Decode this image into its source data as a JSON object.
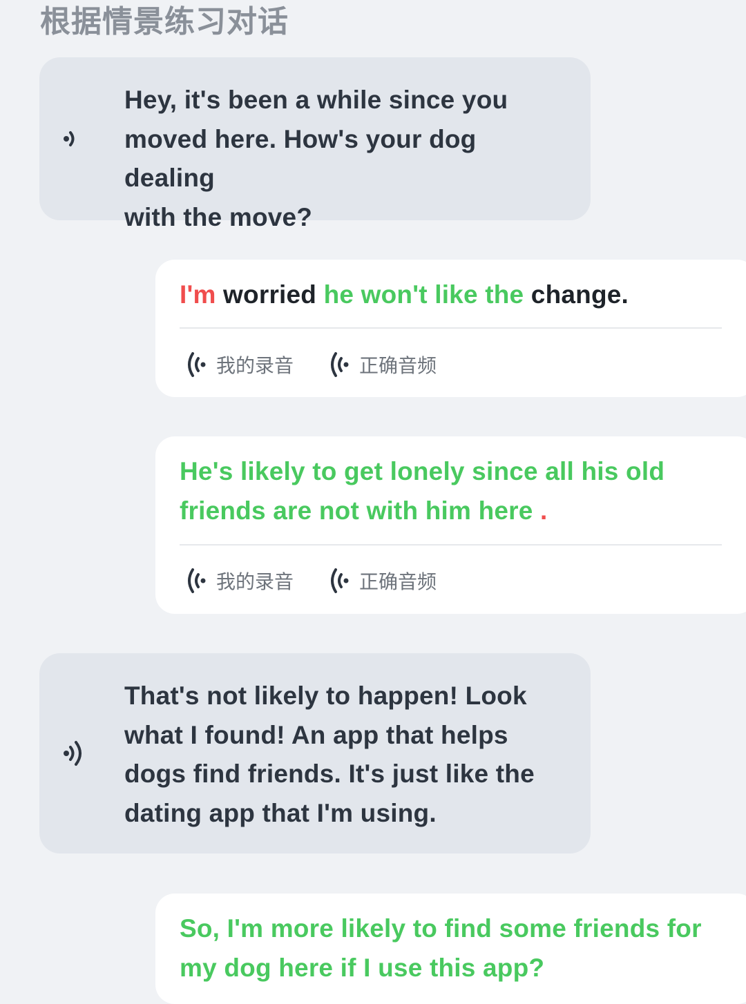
{
  "page": {
    "title": "根据情景练习对话"
  },
  "messages": [
    {
      "role": "partner",
      "text_lines": [
        "Hey, it's been a while since you",
        "moved here. How's your dog dealing",
        "with the move?"
      ],
      "speaker_icon": "speaker-icon"
    },
    {
      "role": "user",
      "segments": [
        {
          "text": "I'm",
          "color": "red"
        },
        {
          "text": " worried ",
          "color": "black"
        },
        {
          "text": "he won't like the",
          "color": "green"
        },
        {
          "text": " change.",
          "color": "black"
        }
      ],
      "my_recording_label": "我的录音",
      "correct_audio_label": "正确音频"
    },
    {
      "role": "user",
      "lines": [
        [
          {
            "text": "He's likely to get lonely since all his old",
            "color": "green"
          }
        ],
        [
          {
            "text": "friends are not with him here",
            "color": "green"
          },
          {
            "text": " .",
            "color": "red"
          }
        ]
      ],
      "my_recording_label": "我的录音",
      "correct_audio_label": "正确音频"
    },
    {
      "role": "partner",
      "text_lines": [
        "That's not likely to happen! Look",
        "what I found! An app that helps",
        "dogs find friends. It's just like the",
        "dating app that I'm using."
      ],
      "speaker_icon": "speaker-icon"
    },
    {
      "role": "user",
      "lines": [
        [
          {
            "text": "So, I'm more likely to find some friends for",
            "color": "green"
          }
        ],
        [
          {
            "text": "my dog here if I use this app?",
            "color": "green"
          }
        ]
      ]
    }
  ],
  "colors": {
    "error": "#f04d4d",
    "correct": "#49c95f",
    "neutral": "#1e2329",
    "partner_bubble": "#e2e6ec",
    "user_bubble": "#ffffff",
    "background": "#f0f2f5"
  }
}
